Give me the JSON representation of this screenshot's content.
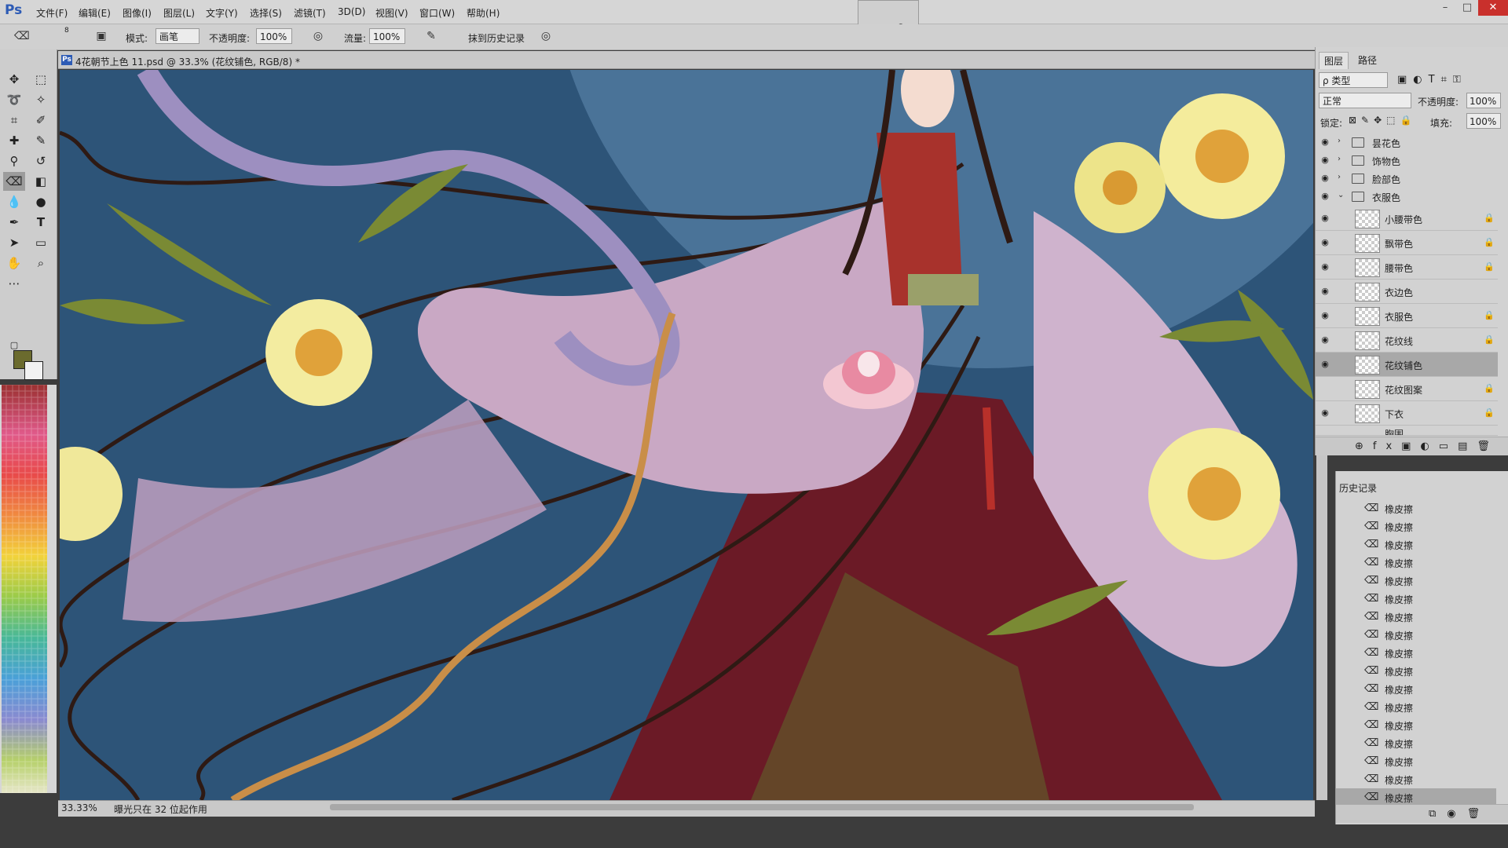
{
  "app": {
    "logo": "Ps"
  },
  "menubar": {
    "items": [
      "文件(F)",
      "编辑(E)",
      "图像(I)",
      "图层(L)",
      "文字(Y)",
      "选择(S)",
      "滤镜(T)",
      "3D(D)",
      "视图(V)",
      "窗口(W)",
      "帮助(H)"
    ]
  },
  "optbar": {
    "brush_size": "8",
    "mode_label": "模式:",
    "mode_value": "画笔",
    "opacity_label": "不透明度:",
    "opacity_value": "100%",
    "flow_label": "流量:",
    "flow_value": "100%",
    "erase_history_label": "抹到历史记录"
  },
  "document": {
    "title": "4花朝节上色 11.psd @ 33.3% (花纹铺色, RGB/8) *",
    "zoom": "33.33%",
    "status": "曝光只在 32 位起作用"
  },
  "layers_panel": {
    "tabs": [
      "图层",
      "路径"
    ],
    "filter_label": "ρ 类型",
    "blend_mode": "正常",
    "opacity_label": "不透明度:",
    "opacity_value": "100%",
    "lock_label": "锁定:",
    "fill_label": "填充:",
    "fill_value": "100%",
    "groups": [
      "昙花色",
      "饰物色",
      "脸部色",
      "衣服色"
    ],
    "layers": [
      {
        "name": "小腰带色",
        "locked": true,
        "selected": false
      },
      {
        "name": "飘带色",
        "locked": true,
        "selected": false
      },
      {
        "name": "腰带色",
        "locked": true,
        "selected": false
      },
      {
        "name": "衣边色",
        "locked": false,
        "selected": false
      },
      {
        "name": "衣服色",
        "locked": true,
        "selected": false
      },
      {
        "name": "花纹线",
        "locked": true,
        "selected": false
      },
      {
        "name": "花纹铺色",
        "locked": false,
        "selected": true
      },
      {
        "name": "花纹图案",
        "locked": true,
        "selected": false
      },
      {
        "name": "下衣",
        "locked": true,
        "selected": false
      },
      {
        "name": "胸围",
        "locked": false,
        "selected": false
      }
    ]
  },
  "history_panel": {
    "title": "历史记录",
    "items": [
      "橡皮擦",
      "橡皮擦",
      "橡皮擦",
      "橡皮擦",
      "橡皮擦",
      "橡皮擦",
      "橡皮擦",
      "橡皮擦",
      "橡皮擦",
      "橡皮擦",
      "橡皮擦",
      "橡皮擦",
      "橡皮擦",
      "橡皮擦",
      "橡皮擦",
      "橡皮擦",
      "橡皮擦"
    ]
  },
  "colors": {
    "foreground": "#6b6b2e",
    "background": "#f2f2f2",
    "canvas_bg": "#2d5478"
  },
  "icons": {
    "eye": "eye-icon",
    "lock": "lock-icon",
    "folder": "folder-icon",
    "eraser": "eraser-icon"
  }
}
